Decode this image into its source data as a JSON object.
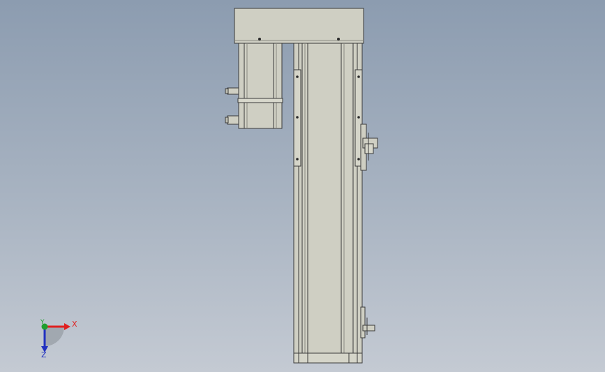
{
  "viewport": {
    "background_top": "#8c9cb0",
    "background_bottom": "#c4cad3"
  },
  "model": {
    "body_color": "#cfcfc3",
    "outline_color": "#3a3a3a",
    "shadow_color": "#8a8a80"
  },
  "triad": {
    "x_label": "X",
    "y_label": "Y",
    "z_label": "Z",
    "x_color": "#e02020",
    "y_color": "#1f9f2f",
    "z_color": "#2030c0"
  }
}
